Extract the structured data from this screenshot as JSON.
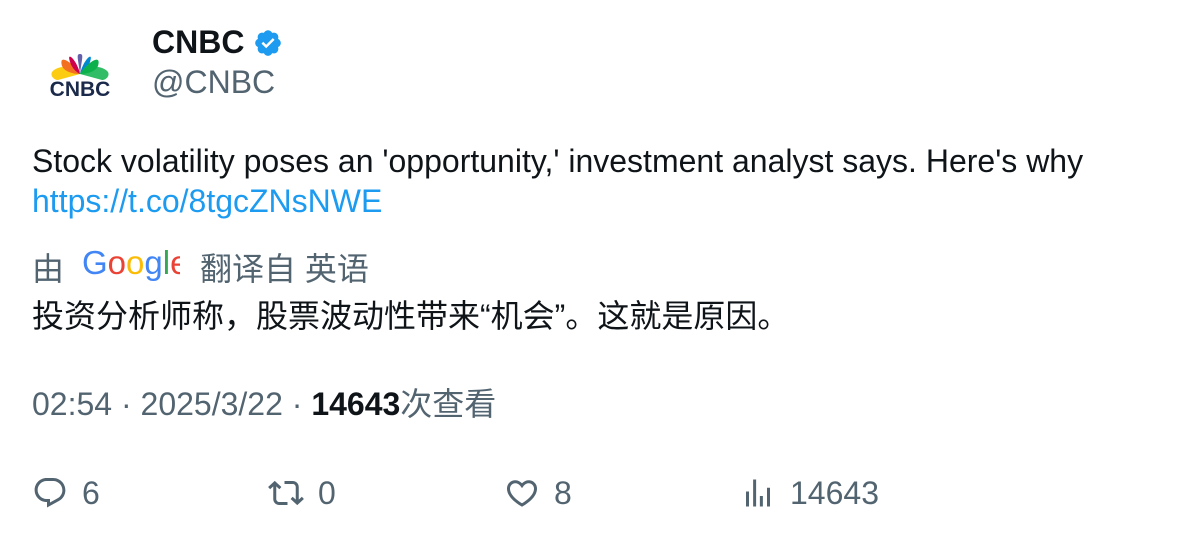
{
  "author": {
    "display_name": "CNBC",
    "handle": "@CNBC",
    "verified": true,
    "avatar_logo_text": "CNBC",
    "verified_color": "#1d9bf0"
  },
  "tweet": {
    "text": "Stock volatility poses an 'opportunity,' investment analyst says. Here's why ",
    "link": "https://t.co/8tgcZNsNWE"
  },
  "translation": {
    "by_label": "由",
    "provider": "Google",
    "source_label": "翻译自 英语",
    "translated_text": "投资分析师称，股票波动性带来“机会”。这就是原因。"
  },
  "meta": {
    "time": "02:54",
    "separator": " · ",
    "date": "2025/3/22",
    "views_count": "14643",
    "views_label": "次查看"
  },
  "actions": {
    "replies": "6",
    "retweets": "0",
    "likes": "8",
    "views": "14643"
  },
  "colors": {
    "text": "#0f1419",
    "secondary": "#536471",
    "link": "#1d9bf0"
  }
}
